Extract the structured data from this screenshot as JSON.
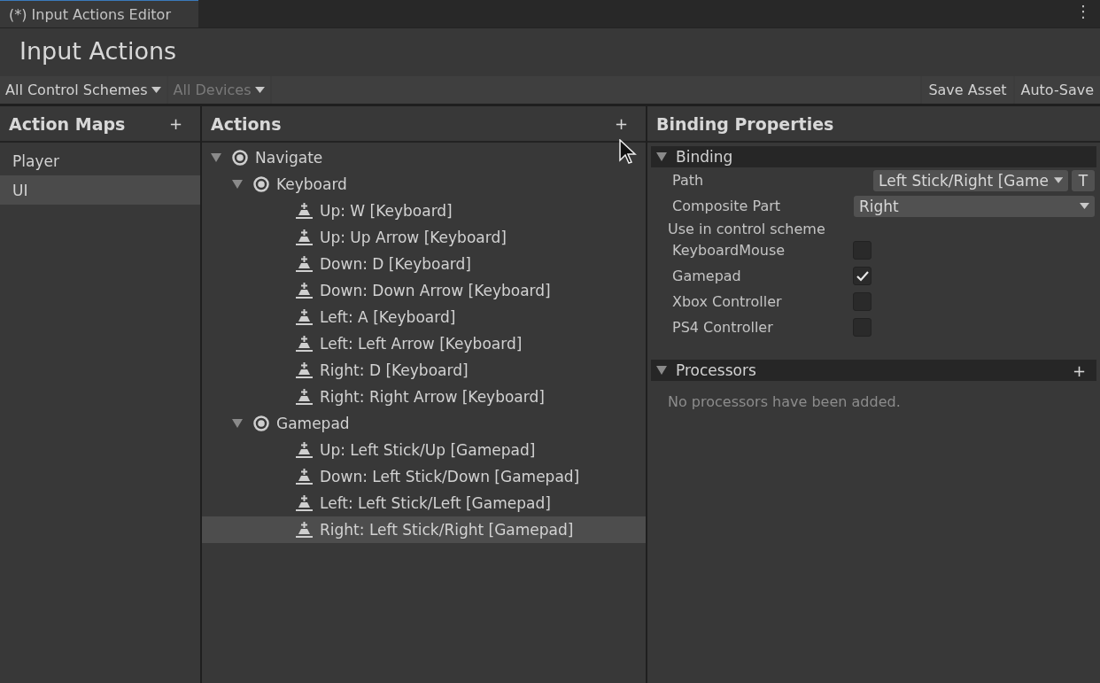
{
  "window": {
    "tab": {
      "title": "(*) Input Actions Editor",
      "selected": true
    },
    "menu_glyph": "⋮"
  },
  "title": "Input Actions",
  "toolbar": {
    "dropdowns": [
      {
        "label": "All Control Schemes",
        "disabled": false
      },
      {
        "label": "All Devices",
        "disabled": true
      }
    ],
    "buttons": [
      {
        "label": "Save Asset",
        "on": false
      },
      {
        "label": "Auto-Save",
        "on": false
      }
    ]
  },
  "action_maps": {
    "title": "Action Maps",
    "add": "+",
    "items": [
      {
        "label": "Player",
        "selected": false
      },
      {
        "label": "UI",
        "selected": true
      }
    ]
  },
  "actions": {
    "title": "Actions",
    "add": "+",
    "tree": [
      {
        "kind": "action",
        "label": "Navigate",
        "expanded": true,
        "selected": false,
        "children": [
          {
            "kind": "composite",
            "label": "Keyboard",
            "expanded": true,
            "selected": false,
            "children": [
              {
                "kind": "binding",
                "label": "Up: W [Keyboard]",
                "selected": false
              },
              {
                "kind": "binding",
                "label": "Up: Up Arrow [Keyboard]",
                "selected": false
              },
              {
                "kind": "binding",
                "label": "Down: D [Keyboard]",
                "selected": false
              },
              {
                "kind": "binding",
                "label": "Down: Down Arrow [Keyboard]",
                "selected": false
              },
              {
                "kind": "binding",
                "label": "Left: A [Keyboard]",
                "selected": false
              },
              {
                "kind": "binding",
                "label": "Left: Left Arrow [Keyboard]",
                "selected": false
              },
              {
                "kind": "binding",
                "label": "Right: D [Keyboard]",
                "selected": false
              },
              {
                "kind": "binding",
                "label": "Right: Right Arrow [Keyboard]",
                "selected": false
              }
            ]
          },
          {
            "kind": "composite",
            "label": "Gamepad",
            "expanded": true,
            "selected": false,
            "children": [
              {
                "kind": "binding",
                "label": "Up: Left Stick/Up [Gamepad]",
                "selected": false
              },
              {
                "kind": "binding",
                "label": "Down: Left Stick/Down [Gamepad]",
                "selected": false
              },
              {
                "kind": "binding",
                "label": "Left: Left Stick/Left [Gamepad]",
                "selected": false
              },
              {
                "kind": "binding",
                "label": "Right: Left Stick/Right [Gamepad]",
                "selected": true
              }
            ]
          }
        ]
      }
    ]
  },
  "properties": {
    "title": "Binding Properties",
    "binding": {
      "title": "Binding",
      "expanded": true,
      "path": {
        "label": "Path",
        "value": "Left Stick/Right [Game",
        "t_button": "T"
      },
      "composite_part": {
        "label": "Composite Part",
        "value": "Right"
      },
      "scheme_label": "Use in control scheme",
      "schemes": [
        {
          "label": "KeyboardMouse",
          "checked": false
        },
        {
          "label": "Gamepad",
          "checked": true
        },
        {
          "label": "Xbox Controller",
          "checked": false
        },
        {
          "label": "PS4 Controller",
          "checked": false
        }
      ]
    },
    "processors": {
      "title": "Processors",
      "expanded": true,
      "add": "+",
      "empty": "No processors have been added."
    }
  }
}
